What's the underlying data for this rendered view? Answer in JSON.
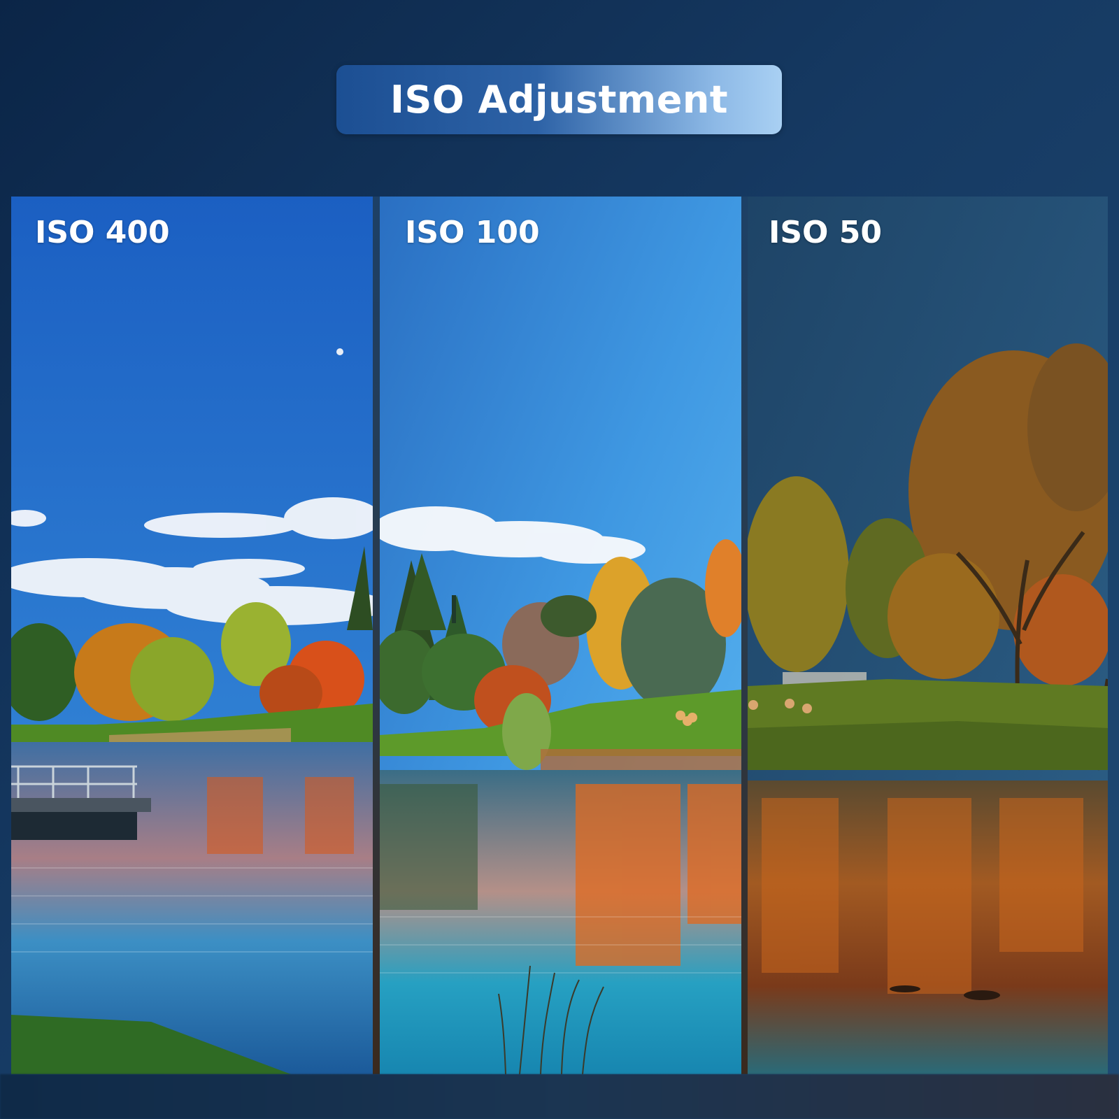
{
  "title": "ISO Adjustment",
  "panels": [
    {
      "label": "ISO 400",
      "sky_top": "#1e63c4",
      "sky_bottom": "#3a86d6",
      "water": "#2a6aa8",
      "tint": "none"
    },
    {
      "label": "ISO 100",
      "sky_top": "#2c75c7",
      "sky_bottom": "#4aa9ec",
      "water": "#2b8fb6",
      "tint": "none"
    },
    {
      "label": "ISO 50",
      "sky_top": "#1f4a70",
      "sky_bottom": "#2d5e82",
      "water": "#7a4a22",
      "tint": "warm-dark"
    }
  ],
  "colors": {
    "background": "#163a63",
    "title_pill_start": "#1c4f93",
    "title_pill_end": "#a9d0f3"
  }
}
